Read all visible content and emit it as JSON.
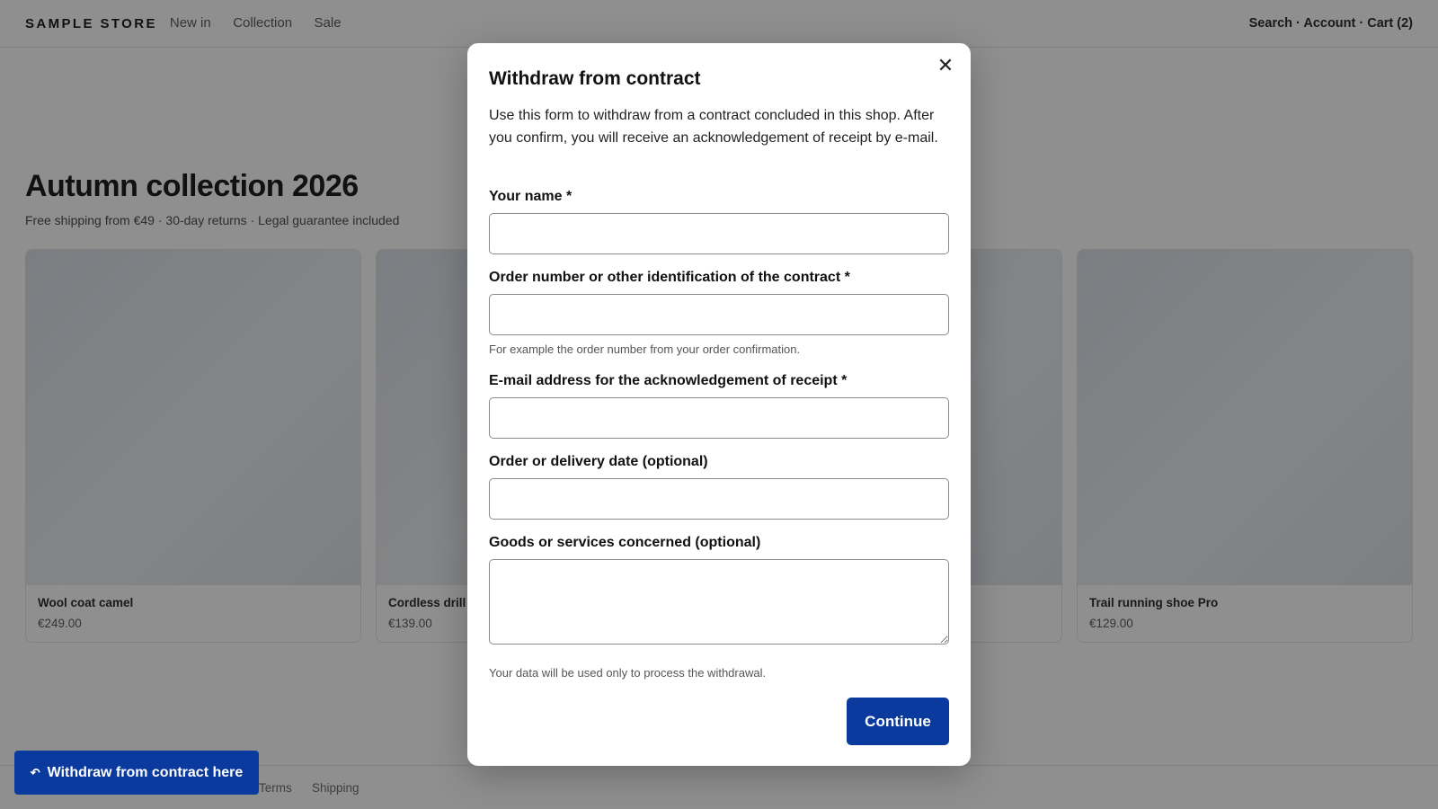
{
  "header": {
    "brand": "SAMPLE STORE",
    "nav": [
      "New in",
      "Collection",
      "Sale"
    ],
    "right": "Search · Account · Cart (2)"
  },
  "hero": {
    "title": "Autumn collection 2026",
    "subtitle": "Free shipping from €49 · 30-day returns · Legal guarantee included"
  },
  "products": [
    {
      "name": "Wool coat camel",
      "price": "€249.00"
    },
    {
      "name": "Cordless drill",
      "price": "€139.00"
    },
    {
      "name": "",
      "price": ""
    },
    {
      "name": "Trail running shoe Pro",
      "price": "€129.00"
    }
  ],
  "footer": {
    "links": [
      "Terms",
      "Shipping"
    ]
  },
  "floating_button": {
    "icon": "undo-arrow-icon",
    "label": "Withdraw from contract here"
  },
  "modal": {
    "title": "Withdraw from contract",
    "close_icon": "close-icon",
    "description": "Use this form to withdraw from a contract concluded in this shop. After you confirm, you will receive an acknowledgement of receipt by e-mail.",
    "fields": {
      "name": {
        "label": "Your name *",
        "value": ""
      },
      "order_number": {
        "label": "Order number or other identification of the contract *",
        "value": "",
        "hint": "For example the order number from your order confirmation."
      },
      "email": {
        "label": "E-mail address for the acknowledgement of receipt *",
        "value": ""
      },
      "date": {
        "label": "Order or delivery date (optional)",
        "value": ""
      },
      "goods": {
        "label": "Goods or services concerned (optional)",
        "value": ""
      }
    },
    "privacy_note": "Your data will be used only to process the withdrawal.",
    "continue_label": "Continue"
  },
  "colors": {
    "primary": "#0b3a9e",
    "overlay": "#121212"
  }
}
